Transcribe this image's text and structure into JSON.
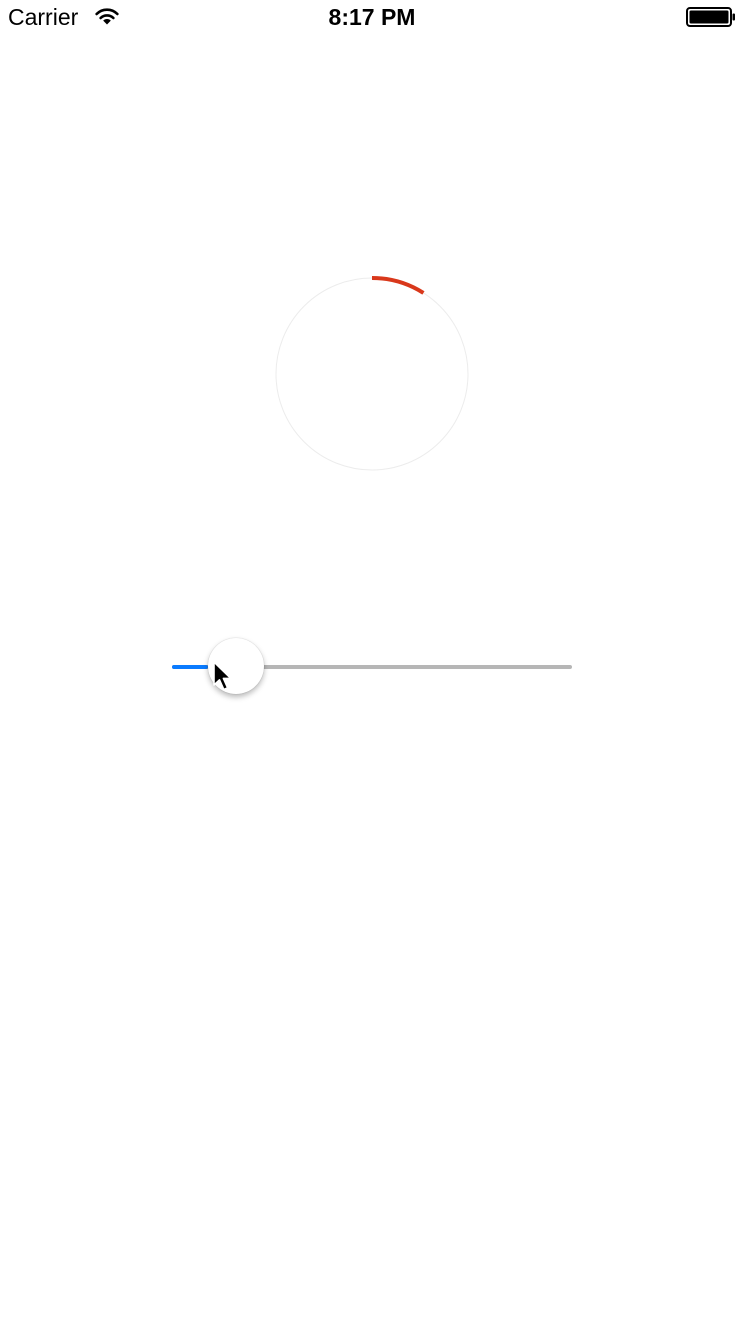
{
  "status_bar": {
    "carrier": "Carrier",
    "time": "8:17 PM",
    "wifi_icon": "wifi-icon",
    "battery_icon": "battery-icon"
  },
  "progress_ring": {
    "progress": 0.09,
    "track_color": "#ececec",
    "progress_color": "#d9381b"
  },
  "slider": {
    "value": 0.09,
    "min": 0,
    "max": 1,
    "fill_color": "#0a7bff",
    "track_color": "#b6b6b6"
  },
  "cursor": {
    "icon": "arrow-cursor-icon"
  }
}
